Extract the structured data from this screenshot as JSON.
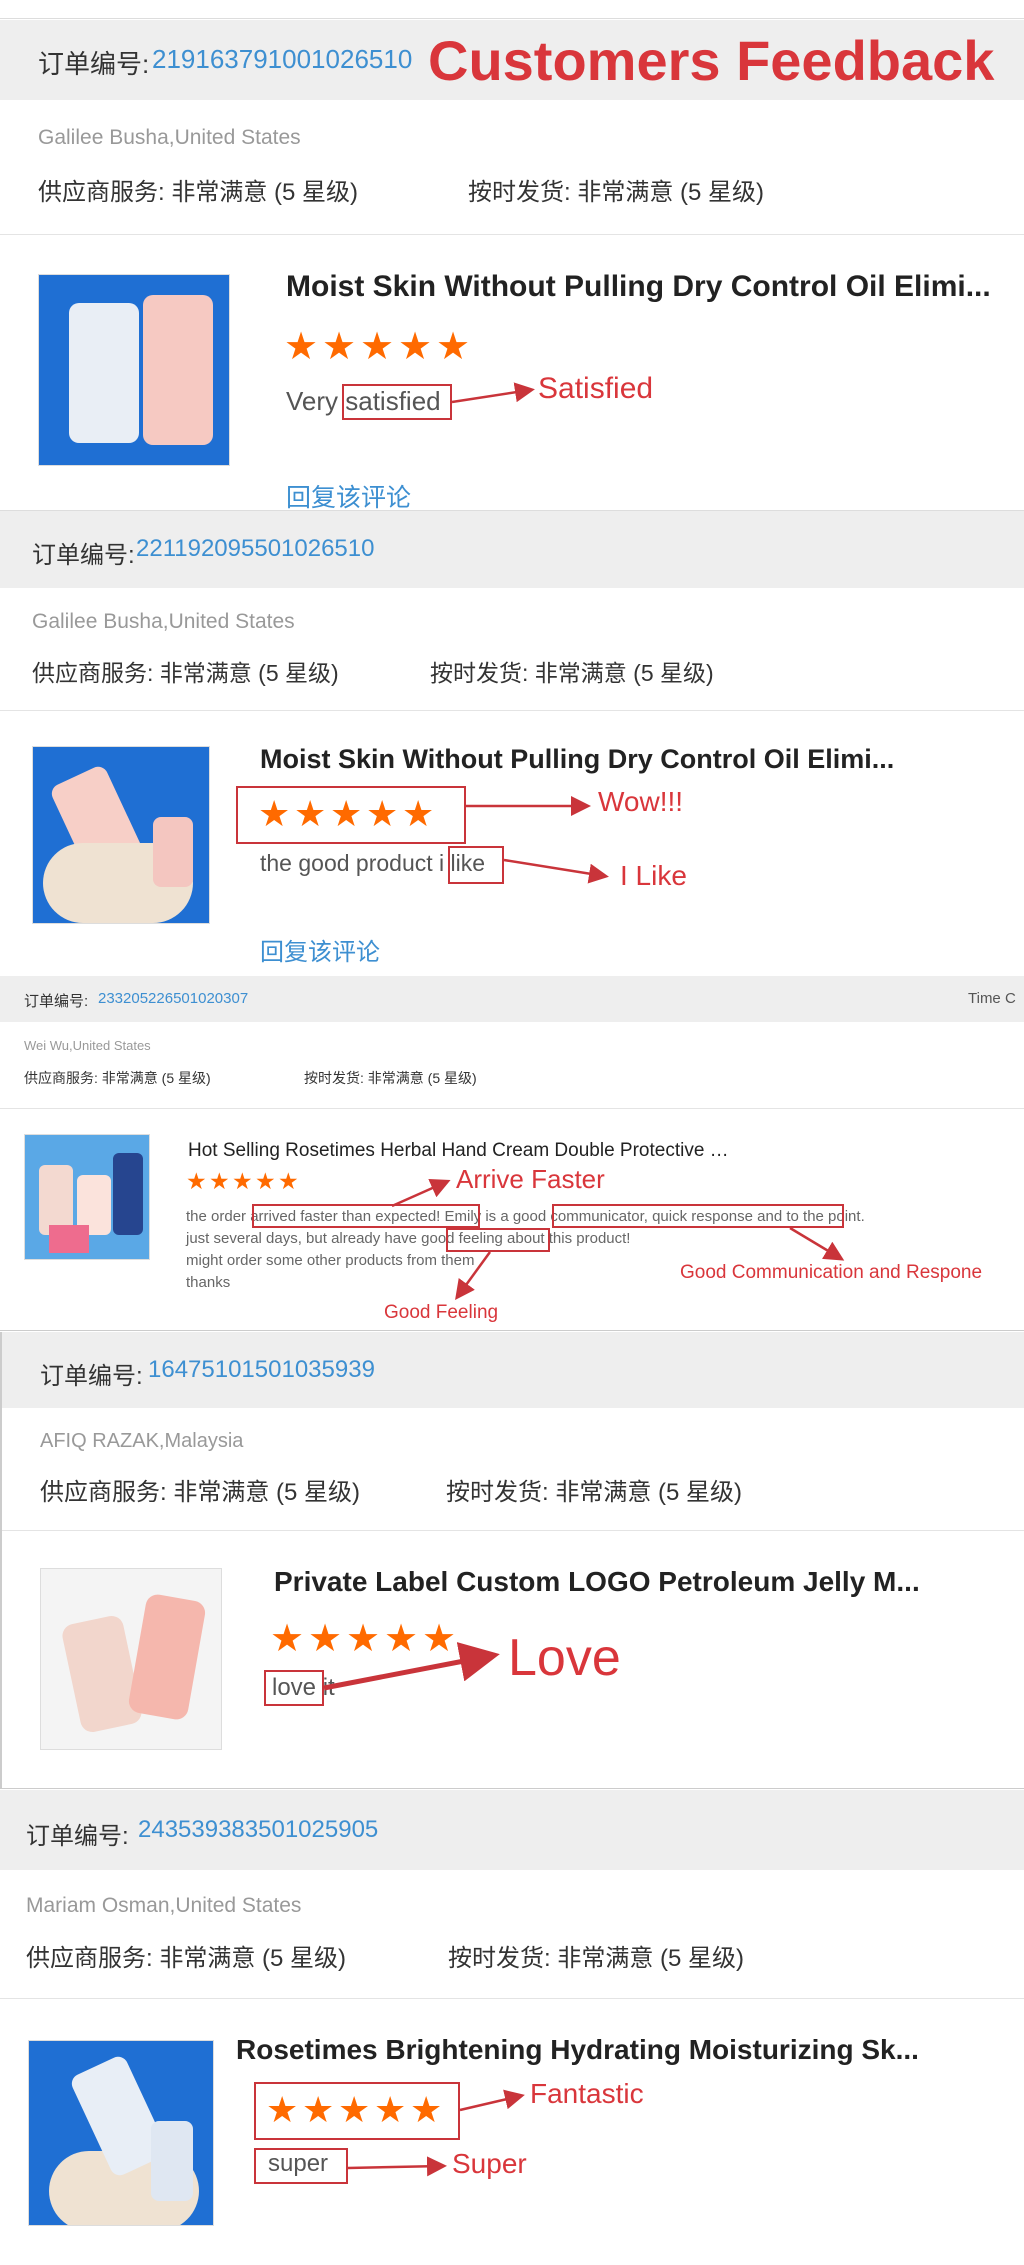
{
  "banner": {
    "title": "Customers Feedback"
  },
  "order_label": "订单编号:",
  "reply_label": "回复该评论",
  "time_label": "Time C",
  "service_label": "供应商服务:",
  "shipping_label": "按时发货:",
  "rating_text": "非常满意",
  "rating_level": "(5 星级)",
  "reviews": [
    {
      "order_no": "219163791001026510",
      "customer": "Galilee Busha,United States",
      "product": "Moist Skin Without Pulling Dry Control Oil Elimi...",
      "stars": 5,
      "comment_pre": "Very ",
      "comment_hl": "satisfied",
      "ann1": "Satisfied"
    },
    {
      "order_no": "221192095501026510",
      "customer": "Galilee Busha,United States",
      "product": "Moist Skin Without Pulling Dry Control Oil Elimi...",
      "stars": 5,
      "comment_pre": "the good product ",
      "comment_hl": "i like",
      "ann1": "Wow!!!",
      "ann2": "I Like"
    },
    {
      "order_no": "233205226501020307",
      "customer": "Wei Wu,United States",
      "product": "Hot Selling Rosetimes Herbal Hand Cream Double Protective …",
      "stars": 5,
      "line1_a": "the order ",
      "line1_b": "arrived faster than expected!",
      "line1_c": " Emily is a ",
      "line1_d": "good communicator, quick response",
      "line1_e": " and to the point.",
      "line2_a": "just several days, but already have ",
      "line2_b": "good feeling",
      "line2_c": " about this product!",
      "line3": "might order some other products from them",
      "line4": "thanks",
      "ann1": "Arrive Faster",
      "ann2": "Good Communication and Respone",
      "ann3": "Good Feeling"
    },
    {
      "order_no": "16475101501035939",
      "customer": "AFIQ RAZAK,Malaysia",
      "product": "Private Label Custom LOGO Petroleum Jelly M...",
      "stars": 5,
      "comment_hl": "love",
      "comment_post": " it",
      "ann1": "Love"
    },
    {
      "order_no": "243539383501025905",
      "customer": "Mariam Osman,United States",
      "product": "Rosetimes Brightening Hydrating Moisturizing Sk...",
      "stars": 5,
      "comment_hl": "super",
      "ann1": "Fantastic",
      "ann2": "Super"
    }
  ]
}
